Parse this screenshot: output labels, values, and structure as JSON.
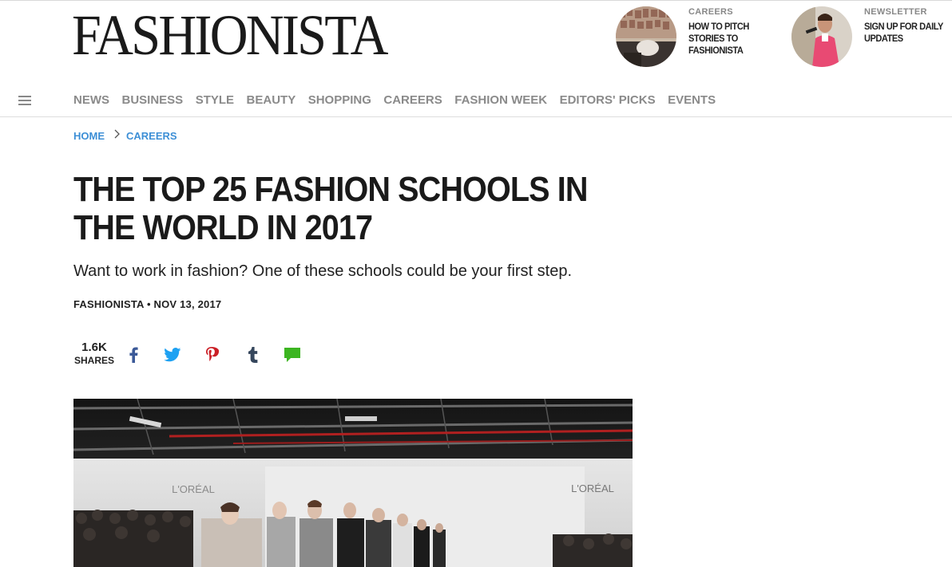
{
  "site": {
    "logo": "FASHIONISTA"
  },
  "promos": [
    {
      "kicker": "CAREERS",
      "headline": "HOW TO PITCH STORIES TO FASHIONISTA"
    },
    {
      "kicker": "NEWSLETTER",
      "headline": "SIGN UP FOR DAILY UPDATES"
    }
  ],
  "nav": {
    "items": [
      "NEWS",
      "BUSINESS",
      "STYLE",
      "BEAUTY",
      "SHOPPING",
      "CAREERS",
      "FASHION WEEK",
      "EDITORS' PICKS",
      "EVENTS"
    ]
  },
  "breadcrumb": {
    "home": "HOME",
    "section": "CAREERS"
  },
  "article": {
    "title": "THE TOP 25 FASHION SCHOOLS IN THE WORLD IN 2017",
    "dek": "Want to work in fashion? One of these schools could be your first step.",
    "byline": "FASHIONISTA • NOV 13, 2017"
  },
  "share": {
    "count": "1.6K",
    "label": "SHARES",
    "buttons": [
      "facebook-icon",
      "twitter-icon",
      "pinterest-icon",
      "tumblr-icon",
      "comment-icon"
    ]
  },
  "hero_image": {
    "signage": [
      "L'ORÉAL",
      "L'ORÉAL"
    ]
  },
  "colors": {
    "link": "#3d8fd6",
    "nav": "#8a8a8a",
    "facebook": "#3b5998",
    "twitter": "#1da1f2",
    "pinterest": "#cb2027",
    "tumblr": "#35465c",
    "comment": "#3cb521"
  }
}
